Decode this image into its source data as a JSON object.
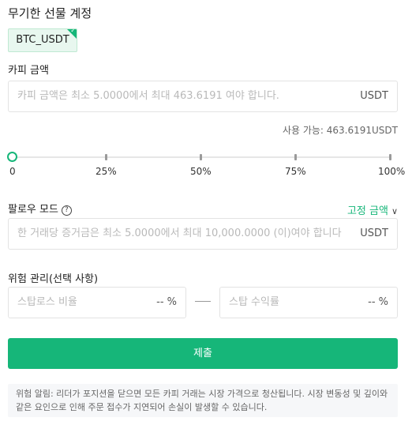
{
  "title": "무기한 선물 계정",
  "pair": {
    "label": "BTC_USDT",
    "check_icon": "check-icon"
  },
  "copy_amount": {
    "label": "카피 금액",
    "placeholder": "카피 금액은 최소 5.0000에서 최대 463.6191 여야 합니다.",
    "unit": "USDT",
    "available": "사용 가능: 463.6191USDT"
  },
  "slider": {
    "value_percent": 0,
    "ticks": [
      "0",
      "25%",
      "50%",
      "75%",
      "100%"
    ]
  },
  "follow_mode": {
    "label": "팔로우 모드",
    "help_icon": "help-circle-icon",
    "selected": "고정 금액",
    "chevron_icon": "chevron-down-icon",
    "placeholder": "한 거래당 증거금은 최소 5.0000에서 최대 10,000.0000 (이)여야 합니다",
    "unit": "USDT"
  },
  "risk": {
    "label": "위험 관리(선택 사항)",
    "stop_loss": {
      "placeholder": "스탑로스 비율",
      "unit": "-- %"
    },
    "take_profit": {
      "placeholder": "스탑 수익률",
      "unit": "-- %"
    }
  },
  "submit_label": "제출",
  "notice": "위험 알림: 리더가 포지션을 닫으면 모든 카피 거래는 시장 가격으로 청산됩니다. 시장 변동성 및 깊이와 같은 요인으로 인해 주문 접수가 지연되어 손실이 발생할 수 있습니다.",
  "colors": {
    "accent": "#16b679",
    "notice_bg": "#f6f7f9"
  }
}
